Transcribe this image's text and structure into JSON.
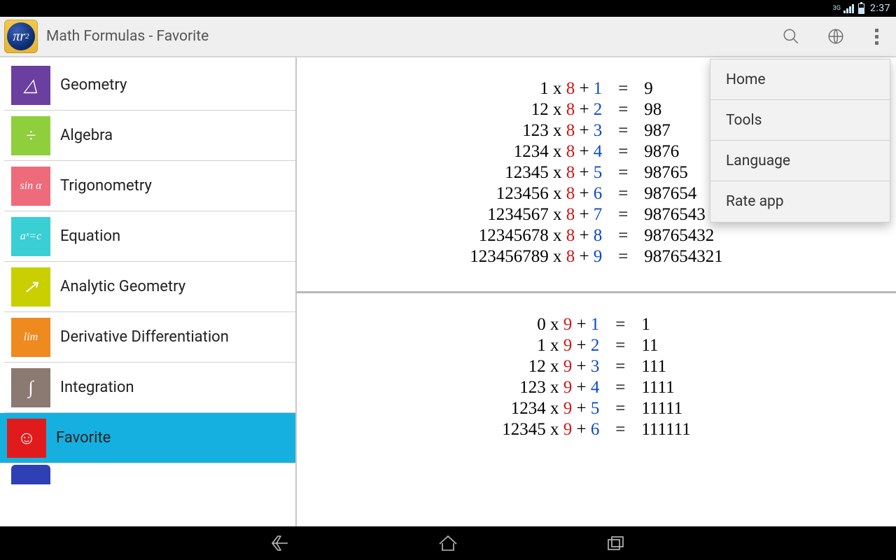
{
  "status": {
    "net_label": "3G",
    "clock": "2:37"
  },
  "action": {
    "app_icon_text": "πr",
    "app_icon_sup": "2",
    "title": "Math Formulas - Favorite"
  },
  "sidebar": {
    "items": [
      {
        "label": "Geometry",
        "color": "#6a3fa0",
        "glyph": "△"
      },
      {
        "label": "Algebra",
        "color": "#8fcf3c",
        "glyph": "÷"
      },
      {
        "label": "Trigonometry",
        "color": "#ee6b7b",
        "glyph": "sin α"
      },
      {
        "label": "Equation",
        "color": "#39cfd4",
        "glyph": "aˣ=c"
      },
      {
        "label": "Analytic Geometry",
        "color": "#c9cf00",
        "glyph": "↗"
      },
      {
        "label": "Derivative Differentiation",
        "color": "#ef8a1f",
        "glyph": "lim"
      },
      {
        "label": "Integration",
        "color": "#8a7a72",
        "glyph": "∫"
      },
      {
        "label": "Favorite",
        "color": "#e11b1b",
        "glyph": "☺",
        "selected": true
      }
    ],
    "peek": {
      "color": "#2f3fb5"
    }
  },
  "content": {
    "blocks": [
      {
        "rows": [
          {
            "a": "1",
            "m": "8",
            "b": "1",
            "r": "9"
          },
          {
            "a": "12",
            "m": "8",
            "b": "2",
            "r": "98"
          },
          {
            "a": "123",
            "m": "8",
            "b": "3",
            "r": "987"
          },
          {
            "a": "1234",
            "m": "8",
            "b": "4",
            "r": "9876"
          },
          {
            "a": "12345",
            "m": "8",
            "b": "5",
            "r": "98765"
          },
          {
            "a": "123456",
            "m": "8",
            "b": "6",
            "r": "987654"
          },
          {
            "a": "1234567",
            "m": "8",
            "b": "7",
            "r": "9876543"
          },
          {
            "a": "12345678",
            "m": "8",
            "b": "8",
            "r": "98765432"
          },
          {
            "a": "123456789",
            "m": "8",
            "b": "9",
            "r": "987654321"
          }
        ]
      },
      {
        "rows": [
          {
            "a": "0",
            "m": "9",
            "b": "1",
            "r": "1"
          },
          {
            "a": "1",
            "m": "9",
            "b": "2",
            "r": "11"
          },
          {
            "a": "12",
            "m": "9",
            "b": "3",
            "r": "111"
          },
          {
            "a": "123",
            "m": "9",
            "b": "4",
            "r": "1111"
          },
          {
            "a": "1234",
            "m": "9",
            "b": "5",
            "r": "11111"
          },
          {
            "a": "12345",
            "m": "9",
            "b": "6",
            "r": "111111"
          }
        ]
      }
    ]
  },
  "menu": {
    "items": [
      {
        "label": "Home"
      },
      {
        "label": "Tools"
      },
      {
        "label": "Language"
      },
      {
        "label": "Rate app"
      }
    ]
  }
}
